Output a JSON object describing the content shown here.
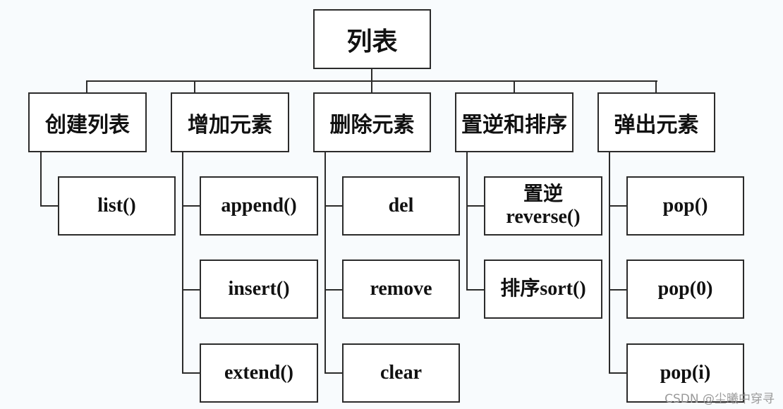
{
  "diagram": {
    "root": "列表",
    "categories": [
      {
        "label": "创建列表",
        "children": [
          "list()"
        ]
      },
      {
        "label": "增加元素",
        "children": [
          "append()",
          "insert()",
          "extend()"
        ]
      },
      {
        "label": "删除元素",
        "children": [
          "del",
          "remove",
          "clear"
        ]
      },
      {
        "label": "置逆和排序",
        "children": [
          [
            "置逆",
            "reverse()"
          ],
          "排序sort()"
        ]
      },
      {
        "label": "弹出元素",
        "children": [
          "pop()",
          "pop(0)",
          "pop(i)"
        ]
      }
    ]
  },
  "watermark": "CSDN @尘曦中穿寻"
}
